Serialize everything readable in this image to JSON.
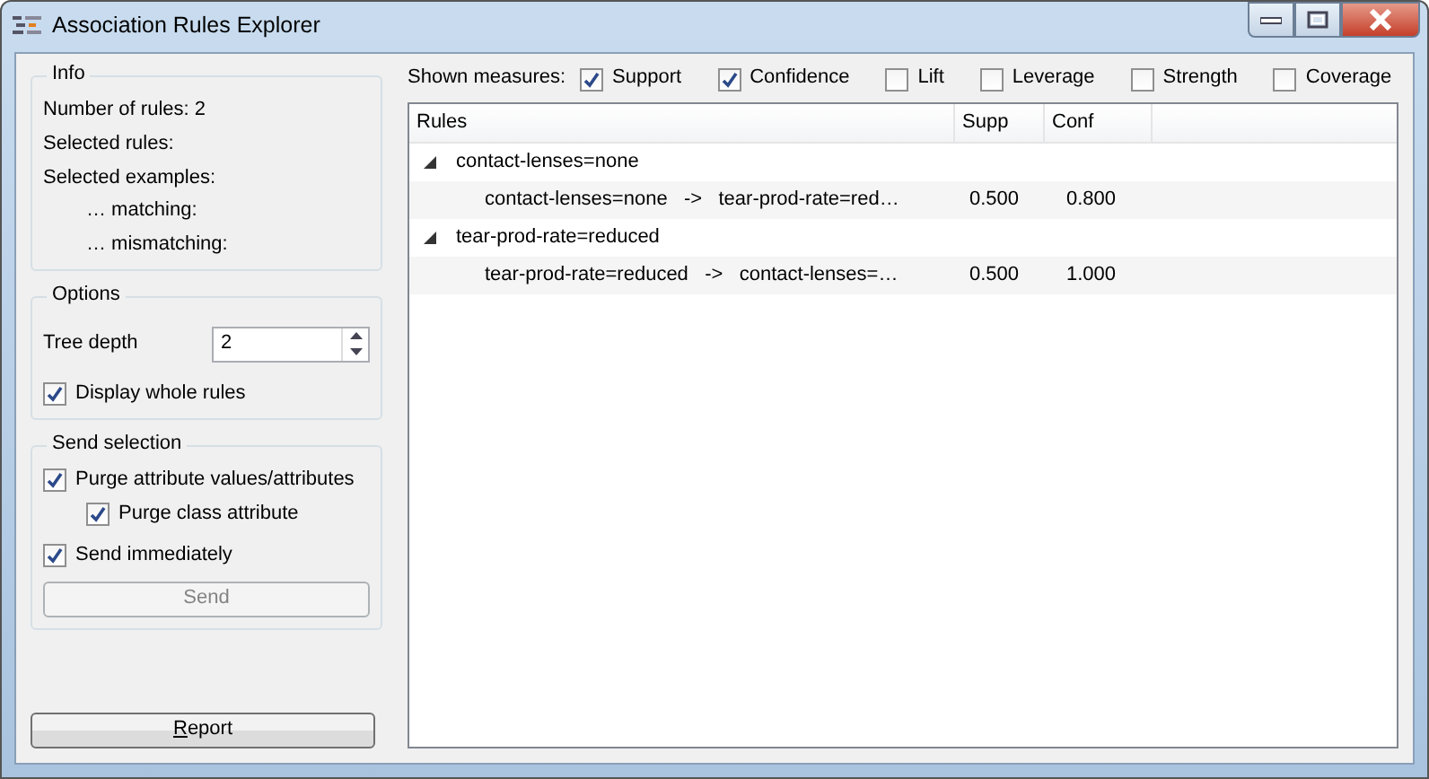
{
  "window": {
    "title": "Association Rules Explorer"
  },
  "info": {
    "title": "Info",
    "lines": [
      "Number of rules: 2",
      "Selected rules:",
      "Selected examples:"
    ],
    "sub_lines": [
      "… matching:",
      "… mismatching:"
    ]
  },
  "options": {
    "title": "Options",
    "tree_depth": {
      "label": "Tree depth",
      "value": "2"
    },
    "display_whole_rules": {
      "label": "Display whole rules",
      "checked": true
    }
  },
  "send_selection": {
    "title": "Send selection",
    "options": [
      {
        "label": "Purge attribute values/attributes",
        "checked": true,
        "children": [
          {
            "label": "Purge class attribute",
            "checked": true
          }
        ]
      },
      {
        "label": "Send immediately",
        "checked": true
      }
    ],
    "send_button": {
      "label": "Send",
      "disabled": true
    }
  },
  "report_button": {
    "label": "Report"
  },
  "measures": {
    "label": "Shown measures:",
    "items": [
      {
        "label": "Support",
        "checked": true
      },
      {
        "label": "Confidence",
        "checked": true
      },
      {
        "label": "Lift",
        "checked": false
      },
      {
        "label": "Leverage",
        "checked": false
      },
      {
        "label": "Strength",
        "checked": false
      },
      {
        "label": "Coverage",
        "checked": false
      }
    ]
  },
  "tree": {
    "columns": [
      "Rules",
      "Supp",
      "Conf"
    ],
    "rows": [
      {
        "label": "contact-lenses=none",
        "expanded": true,
        "children": [
          {
            "rule": "contact-lenses=none   ->   tear-prod-rate=red…",
            "supp": "0.500",
            "conf": "0.800"
          }
        ]
      },
      {
        "label": "tear-prod-rate=reduced",
        "expanded": true,
        "children": [
          {
            "rule": "tear-prod-rate=reduced   ->   contact-lenses=…",
            "supp": "0.500",
            "conf": "1.000"
          }
        ]
      }
    ]
  }
}
